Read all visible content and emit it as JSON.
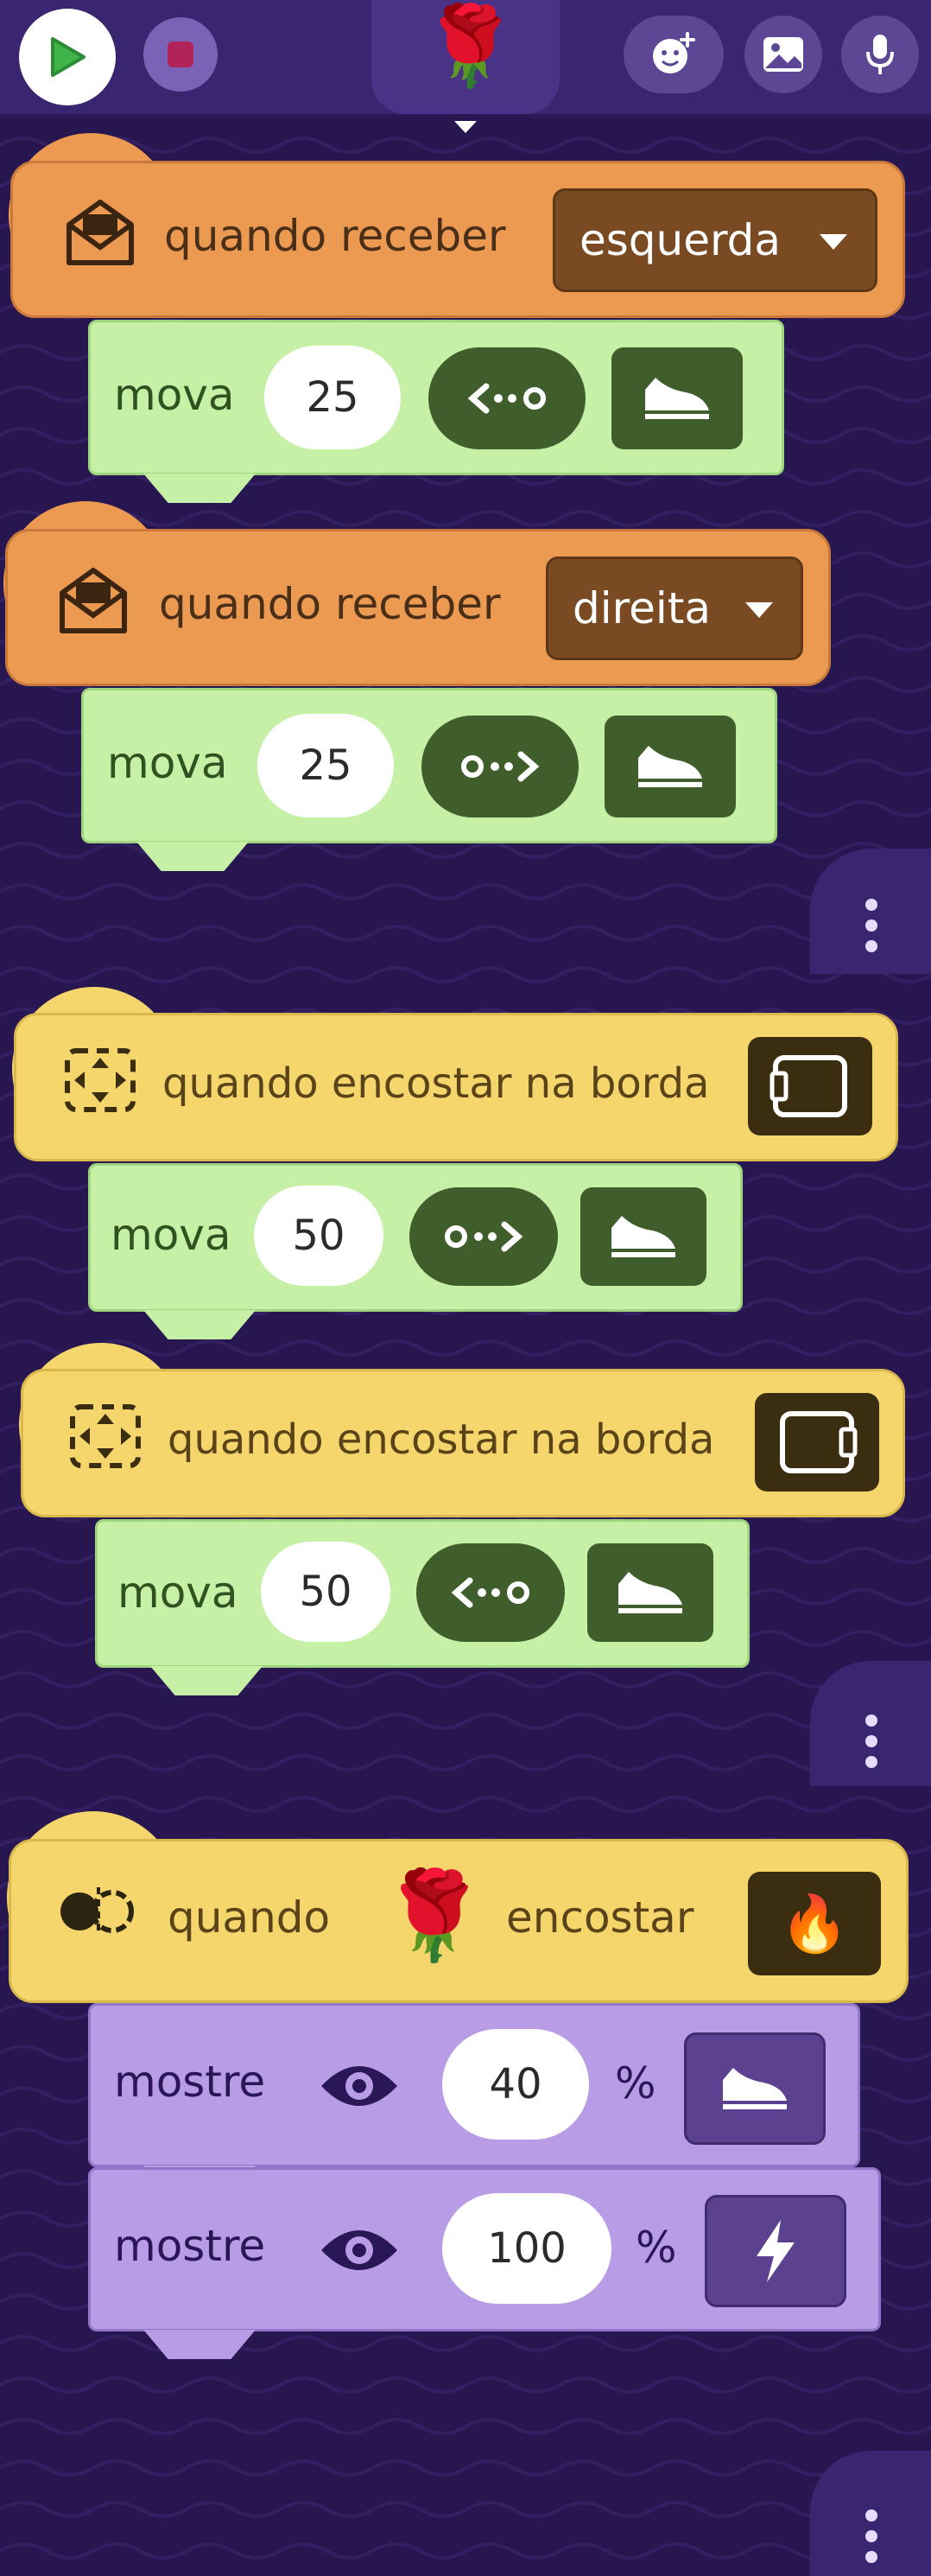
{
  "topbar": {
    "play_icon": "play-icon",
    "stop_icon": "stop-icon",
    "sprite_emoji": "🌹",
    "add_sprite_icon": "add-sprite-icon",
    "background_icon": "image-icon",
    "mic_icon": "microphone-icon"
  },
  "scripts": [
    {
      "hat": {
        "label": "quando receber",
        "dropdown": "esquerda",
        "icon": "envelope-icon",
        "color": "#ec9a52"
      },
      "cmd": {
        "label": "mova",
        "value": "25",
        "direction": "left-arrow-icon",
        "action": "shoe-icon"
      }
    },
    {
      "hat": {
        "label": "quando receber",
        "dropdown": "direita",
        "icon": "envelope-icon",
        "color": "#ec9a52"
      },
      "cmd": {
        "label": "mova",
        "value": "25",
        "direction": "right-arrow-icon",
        "action": "shoe-icon"
      }
    },
    {
      "hat": {
        "label": "quando encostar na borda",
        "icon": "bounds-icon",
        "edge": "left-edge-icon",
        "color": "#f4d66c"
      },
      "cmd": {
        "label": "mova",
        "value": "50",
        "direction": "right-arrow-icon",
        "action": "shoe-icon"
      }
    },
    {
      "hat": {
        "label": "quando encostar na borda",
        "icon": "bounds-icon",
        "edge": "right-edge-icon",
        "color": "#f4d66c"
      },
      "cmd": {
        "label": "mova",
        "value": "50",
        "direction": "left-arrow-icon",
        "action": "shoe-icon"
      }
    },
    {
      "hat": {
        "label_before": "quando",
        "sprite": "🌹",
        "label_after": "encostar",
        "target": "🔥",
        "icon": "collision-icon",
        "color": "#f4d66c"
      },
      "cmds": [
        {
          "label": "mostre",
          "value": "40",
          "unit": "%",
          "action": "shoe-icon"
        },
        {
          "label": "mostre",
          "value": "100",
          "unit": "%",
          "action": "lightning-icon"
        }
      ]
    }
  ]
}
